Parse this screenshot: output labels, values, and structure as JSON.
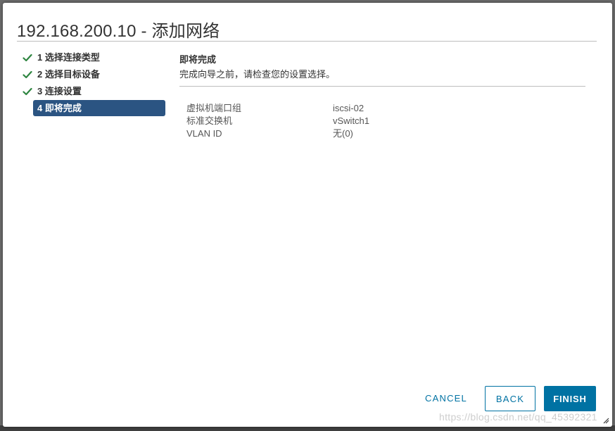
{
  "dialog": {
    "title": "192.168.200.10 - 添加网络"
  },
  "steps": [
    {
      "label": "1 选择连接类型",
      "completed": true,
      "icon": "checkmark-icon"
    },
    {
      "label": "2 选择目标设备",
      "completed": true,
      "icon": "checkmark-icon"
    },
    {
      "label": "3 连接设置",
      "completed": true,
      "icon": "checkmark-icon"
    },
    {
      "label": "4 即将完成",
      "completed": false,
      "active": true
    }
  ],
  "content": {
    "heading": "即将完成",
    "subheading": "完成向导之前，请检查您的设置选择。",
    "summary": [
      {
        "key": "虚拟机端口组",
        "value": "iscsi-02"
      },
      {
        "key": "标准交换机",
        "value": "vSwitch1"
      },
      {
        "key": "VLAN ID",
        "value": "无(0)"
      }
    ]
  },
  "footer": {
    "cancel_label": "CANCEL",
    "back_label": "BACK",
    "finish_label": "FINISH"
  },
  "watermark": "https://blog.csdn.net/qq_45392321",
  "colors": {
    "primary": "#0072a3",
    "active_step": "#2b5482",
    "check": "#2e8540"
  }
}
